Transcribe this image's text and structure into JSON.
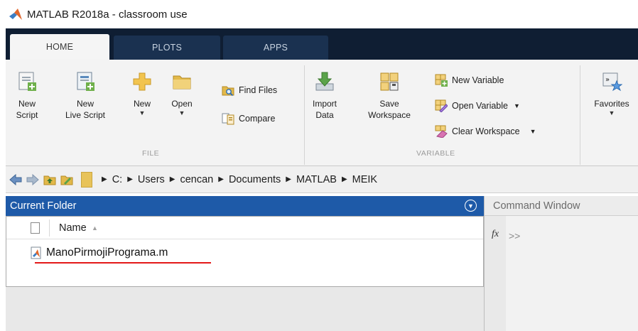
{
  "window": {
    "title": "MATLAB R2018a - classroom use"
  },
  "tabs": [
    {
      "label": "HOME",
      "active": true
    },
    {
      "label": "PLOTS",
      "active": false
    },
    {
      "label": "APPS",
      "active": false
    }
  ],
  "ribbon": {
    "file": {
      "group_label": "FILE",
      "new_script": {
        "line1": "New",
        "line2": "Script",
        "icon": "new-script-icon"
      },
      "new_live_script": {
        "line1": "New",
        "line2": "Live Script",
        "icon": "new-live-script-icon"
      },
      "new": {
        "label": "New",
        "icon": "plus-icon"
      },
      "open": {
        "label": "Open",
        "icon": "folder-icon"
      },
      "find_files": {
        "label": "Find Files",
        "icon": "find-files-icon"
      },
      "compare": {
        "label": "Compare",
        "icon": "compare-icon"
      }
    },
    "variable": {
      "group_label": "VARIABLE",
      "import_data": {
        "line1": "Import",
        "line2": "Data",
        "icon": "import-icon"
      },
      "save_workspace": {
        "line1": "Save",
        "line2": "Workspace",
        "icon": "save-workspace-icon"
      },
      "new_variable": {
        "label": "New Variable",
        "icon": "new-variable-icon"
      },
      "open_variable": {
        "label": "Open Variable",
        "icon": "open-variable-icon"
      },
      "clear_workspace": {
        "label": "Clear Workspace",
        "icon": "clear-workspace-icon"
      }
    },
    "favorites": {
      "label": "Favorites",
      "icon": "favorites-icon"
    }
  },
  "address": {
    "path": [
      "C:",
      "Users",
      "cencan",
      "Documents",
      "MATLAB",
      "MEIK"
    ]
  },
  "current_folder": {
    "title": "Current Folder",
    "column_name": "Name",
    "files": [
      {
        "name": "ManoPirmojiPrograma.m",
        "icon": "matlab-file-icon"
      }
    ]
  },
  "command_window": {
    "title": "Command Window",
    "fx": "fx",
    "prompt": ">>"
  },
  "colors": {
    "panel_header": "#1e5aa8",
    "tab_strip": "#0f1e33",
    "underline": "#e31919"
  }
}
